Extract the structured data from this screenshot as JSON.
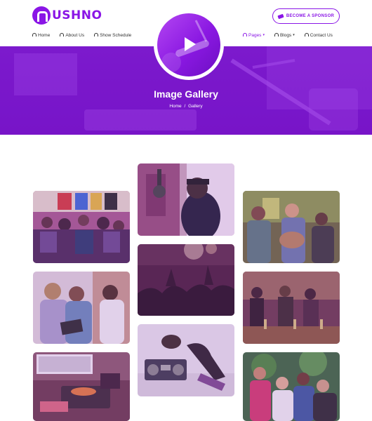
{
  "brand": {
    "name": "USHNO"
  },
  "header": {
    "sponsor_button": "BECOME A SPONSOR",
    "nav_left": [
      {
        "label": "Home"
      },
      {
        "label": "About Us"
      },
      {
        "label": "Show Schedule"
      }
    ],
    "nav_right": [
      {
        "label": "Pages",
        "active": true,
        "dropdown": true
      },
      {
        "label": "Blogs",
        "dropdown": true
      },
      {
        "label": "Contact Us"
      }
    ]
  },
  "hero": {
    "title": "Image Gallery",
    "breadcrumb": {
      "home": "Home",
      "separator": "/",
      "current": "Gallery"
    }
  },
  "colors": {
    "accent": "#8a15e6",
    "hero": "#8a18e2",
    "tile_tint": "#a04fd0"
  },
  "gallery": [
    {
      "name": "recording-studio-singer"
    },
    {
      "name": "crowd-audience"
    },
    {
      "name": "acoustic-band"
    },
    {
      "name": "friends-reading-tablet"
    },
    {
      "name": "concert-crowd-hands"
    },
    {
      "name": "bar-gathering"
    },
    {
      "name": "vinyl-record-player"
    },
    {
      "name": "woman-with-boombox"
    },
    {
      "name": "group-selfie-outdoors"
    }
  ]
}
